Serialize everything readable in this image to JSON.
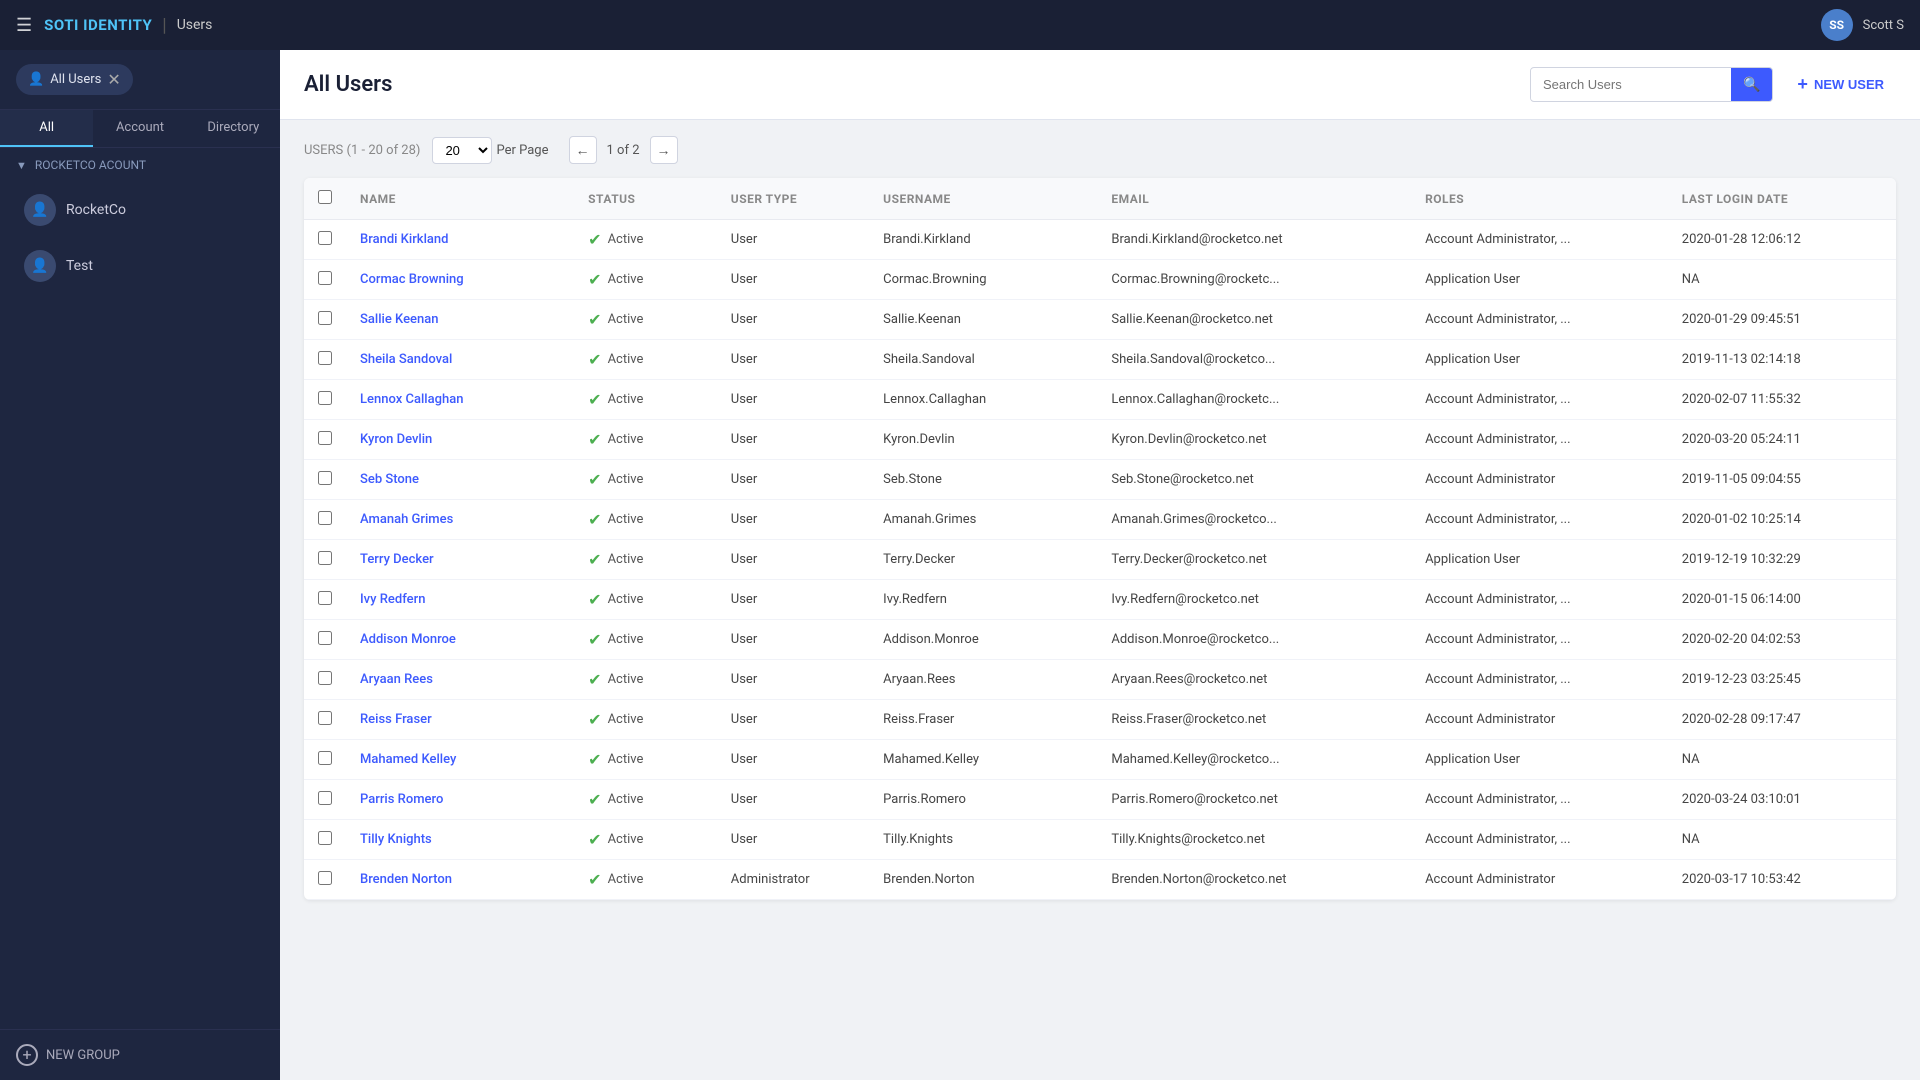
{
  "app": {
    "logo_text": "SOTI",
    "logo_accent": "IDENTITY",
    "section": "Users",
    "username": "Scott S",
    "avatar_initials": "SS"
  },
  "sidebar": {
    "filter_label": "All Users",
    "tabs": [
      {
        "label": "All",
        "active": true
      },
      {
        "label": "Account"
      },
      {
        "label": "Directory"
      }
    ],
    "group_label": "ROCKETCO ACOUNT",
    "items": [
      {
        "label": "RocketCo",
        "icon": "👤"
      },
      {
        "label": "Test",
        "icon": "👤"
      }
    ],
    "new_group_label": "NEW GROUP"
  },
  "header": {
    "title": "All Users",
    "search_placeholder": "Search Users",
    "new_user_label": "NEW USER"
  },
  "toolbar": {
    "count_label": "USERS",
    "count_range": "(1 - 20 of 28)",
    "per_page_value": "20",
    "per_page_label": "Per Page",
    "page_info": "1 of 2",
    "prev_arrow": "←",
    "next_arrow": "→"
  },
  "table": {
    "columns": [
      "",
      "NAME",
      "STATUS",
      "USER TYPE",
      "USERNAME",
      "EMAIL",
      "ROLES",
      "LAST LOGIN DATE"
    ],
    "rows": [
      {
        "name": "Brandi Kirkland",
        "status": "Active",
        "user_type": "User",
        "username": "Brandi.Kirkland",
        "email": "Brandi.Kirkland@rocketco.net",
        "roles": "Account Administrator, ...",
        "last_login": "2020-01-28 12:06:12"
      },
      {
        "name": "Cormac Browning",
        "status": "Active",
        "user_type": "User",
        "username": "Cormac.Browning",
        "email": "Cormac.Browning@rocketc...",
        "roles": "Application User",
        "last_login": "NA"
      },
      {
        "name": "Sallie Keenan",
        "status": "Active",
        "user_type": "User",
        "username": "Sallie.Keenan",
        "email": "Sallie.Keenan@rocketco.net",
        "roles": "Account Administrator, ...",
        "last_login": "2020-01-29 09:45:51"
      },
      {
        "name": "Sheila Sandoval",
        "status": "Active",
        "user_type": "User",
        "username": "Sheila.Sandoval",
        "email": "Sheila.Sandoval@rocketco...",
        "roles": "Application User",
        "last_login": "2019-11-13 02:14:18"
      },
      {
        "name": "Lennox Callaghan",
        "status": "Active",
        "user_type": "User",
        "username": "Lennox.Callaghan",
        "email": "Lennox.Callaghan@rocketc...",
        "roles": "Account Administrator, ...",
        "last_login": "2020-02-07 11:55:32"
      },
      {
        "name": "Kyron Devlin",
        "status": "Active",
        "user_type": "User",
        "username": "Kyron.Devlin",
        "email": "Kyron.Devlin@rocketco.net",
        "roles": "Account Administrator, ...",
        "last_login": "2020-03-20 05:24:11"
      },
      {
        "name": "Seb Stone",
        "status": "Active",
        "user_type": "User",
        "username": "Seb.Stone",
        "email": "Seb.Stone@rocketco.net",
        "roles": "Account Administrator",
        "last_login": "2019-11-05 09:04:55"
      },
      {
        "name": "Amanah Grimes",
        "status": "Active",
        "user_type": "User",
        "username": "Amanah.Grimes",
        "email": "Amanah.Grimes@rocketco...",
        "roles": "Account Administrator, ...",
        "last_login": "2020-01-02 10:25:14"
      },
      {
        "name": "Terry Decker",
        "status": "Active",
        "user_type": "User",
        "username": "Terry.Decker",
        "email": "Terry.Decker@rocketco.net",
        "roles": "Application User",
        "last_login": "2019-12-19 10:32:29"
      },
      {
        "name": "Ivy Redfern",
        "status": "Active",
        "user_type": "User",
        "username": "Ivy.Redfern",
        "email": "Ivy.Redfern@rocketco.net",
        "roles": "Account Administrator, ...",
        "last_login": "2020-01-15 06:14:00"
      },
      {
        "name": "Addison Monroe",
        "status": "Active",
        "user_type": "User",
        "username": "Addison.Monroe",
        "email": "Addison.Monroe@rocketco...",
        "roles": "Account Administrator, ...",
        "last_login": "2020-02-20 04:02:53"
      },
      {
        "name": "Aryaan Rees",
        "status": "Active",
        "user_type": "User",
        "username": "Aryaan.Rees",
        "email": "Aryaan.Rees@rocketco.net",
        "roles": "Account Administrator, ...",
        "last_login": "2019-12-23 03:25:45"
      },
      {
        "name": "Reiss Fraser",
        "status": "Active",
        "user_type": "User",
        "username": "Reiss.Fraser",
        "email": "Reiss.Fraser@rocketco.net",
        "roles": "Account Administrator",
        "last_login": "2020-02-28 09:17:47"
      },
      {
        "name": "Mahamed Kelley",
        "status": "Active",
        "user_type": "User",
        "username": "Mahamed.Kelley",
        "email": "Mahamed.Kelley@rocketco...",
        "roles": "Application User",
        "last_login": "NA"
      },
      {
        "name": "Parris Romero",
        "status": "Active",
        "user_type": "User",
        "username": "Parris.Romero",
        "email": "Parris.Romero@rocketco.net",
        "roles": "Account Administrator, ...",
        "last_login": "2020-03-24 03:10:01"
      },
      {
        "name": "Tilly Knights",
        "status": "Active",
        "user_type": "User",
        "username": "Tilly.Knights",
        "email": "Tilly.Knights@rocketco.net",
        "roles": "Account Administrator, ...",
        "last_login": "NA"
      },
      {
        "name": "Brenden Norton",
        "status": "Active",
        "user_type": "Administrator",
        "username": "Brenden.Norton",
        "email": "Brenden.Norton@rocketco.net",
        "roles": "Account Administrator",
        "last_login": "2020-03-17 10:53:42"
      }
    ]
  }
}
